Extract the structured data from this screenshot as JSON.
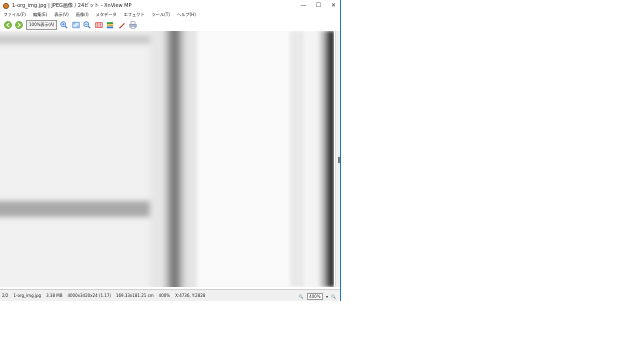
{
  "window": {
    "title": "1-org_img.jpg | JPEG画像 / 24ビット - XnView MP",
    "controls": {
      "minimize": "—",
      "maximize": "☐",
      "close": "✕"
    }
  },
  "menu": {
    "items": [
      "ファイル(F)",
      "編集(E)",
      "表示(V)",
      "画像(I)",
      "メタデータ",
      "エフェクト",
      "ツール(T)",
      "ヘルプ(H)"
    ]
  },
  "toolbar": {
    "buttons": [
      {
        "icon": "back-icon",
        "color": "#7cbf3a"
      },
      {
        "icon": "forward-icon",
        "color": "#7cbf3a"
      },
      {
        "label": "100%表示(A)"
      },
      {
        "icon": "zoom-in-icon",
        "color": "#3a7bd5"
      },
      {
        "icon": "fit-window-icon",
        "color": "#3a7bd5"
      },
      {
        "icon": "zoom-out-icon",
        "color": "#3a7bd5"
      },
      {
        "icon": "film-strip-icon",
        "color": "#d23a3a"
      },
      {
        "icon": "layers-icon",
        "color": "#3a9a3a"
      },
      {
        "icon": "edit-brush-icon",
        "color": "#c0392b"
      },
      {
        "icon": "print-icon",
        "color": "#5a6e8a"
      }
    ]
  },
  "statusbar": {
    "index": "2/2",
    "filename": "1-org_img.jpg",
    "filesize": "3.38 MB",
    "dimensions": "4000x3420x24 (1.17)",
    "physical_size": "169.33x181.21 cm",
    "zoom": "400%",
    "coordinates": "X:4736, Y:2828",
    "zoom_select": "400%"
  }
}
